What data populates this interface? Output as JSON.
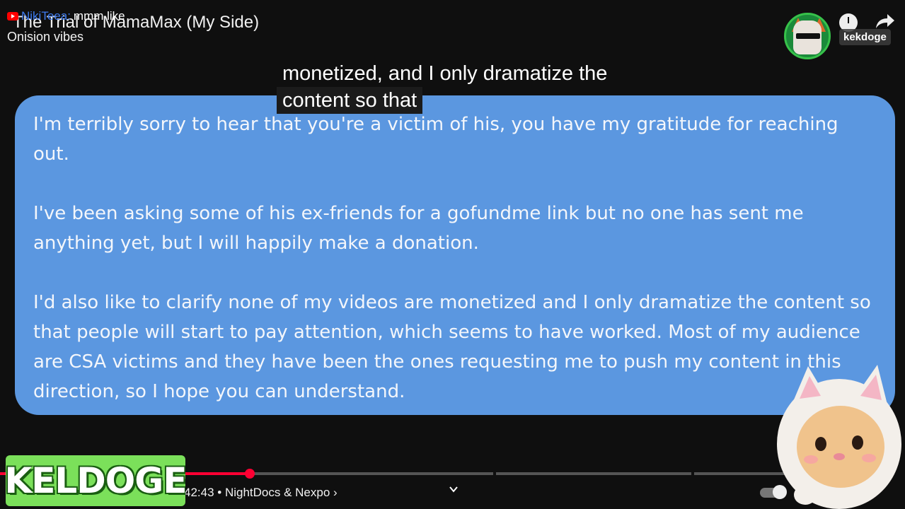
{
  "video": {
    "title": "The Trial of MamaMax (My Side)",
    "time": "42:43",
    "chapter": "• NightDocs & Nexpo ›",
    "progress_fraction": 0.28
  },
  "chat": {
    "username": "NikiTeea:",
    "message": "mmm like",
    "continuation": "Onision vibes"
  },
  "channel": {
    "name": "kekdoge"
  },
  "caption": {
    "line1": "monetized, and I only dramatize the",
    "line2": "content so that"
  },
  "message_bubble": {
    "paragraphs": [
      "I'm terribly sorry to hear that you're a victim of his, you have my gratitude for reaching out.",
      "I've been asking some of his ex-friends for a gofundme link but no one has sent me anything yet, but I will happily make a donation.",
      "I'd also like to clarify none of my videos are monetized and I only dramatize the content so that people will start to pay attention, which seems to have worked. Most of my audience are CSA victims and they have been the ones requesting me to push my content in this direction, so I hope you can understand."
    ],
    "color": "#5b97e0"
  },
  "overlay": {
    "logo_text": "KELDOGE"
  },
  "colors": {
    "progress_played": "#ff0033",
    "background": "#0f0f0f",
    "chat_user": "#3d7bf0"
  },
  "icons": [
    "youtube-icon",
    "clock-icon",
    "share-icon",
    "chevron-down-icon",
    "autoplay-toggle-icon"
  ]
}
